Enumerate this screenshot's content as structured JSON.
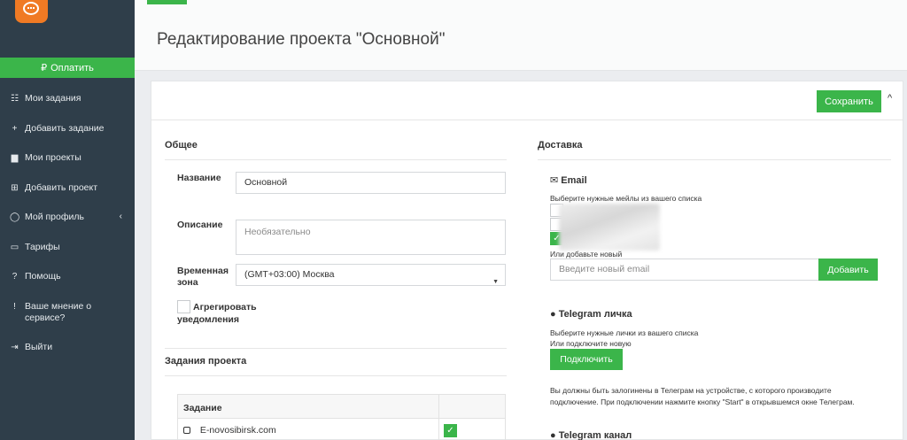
{
  "sidebar": {
    "pay_label": "Оплатить",
    "items": [
      {
        "label": "Мои задания",
        "icon": "list-icon",
        "glyph": "☷"
      },
      {
        "label": "Добавить задание",
        "icon": "plus-icon",
        "glyph": "+"
      },
      {
        "label": "Мои проекты",
        "icon": "briefcase-icon",
        "glyph": "▆"
      },
      {
        "label": "Добавить проект",
        "icon": "plus-square-icon",
        "glyph": "⊞"
      },
      {
        "label": "Мой профиль",
        "icon": "user-icon",
        "glyph": "◯"
      },
      {
        "label": "Тарифы",
        "icon": "card-icon",
        "glyph": "▭"
      },
      {
        "label": "Помощь",
        "icon": "question-icon",
        "glyph": "?"
      },
      {
        "label": "Ваше мнение о сервисе?",
        "icon": "exclamation-icon",
        "glyph": "!"
      },
      {
        "label": "Выйти",
        "icon": "sign-out-icon",
        "glyph": "⇥"
      }
    ],
    "profile_chevron": "‹"
  },
  "header": {
    "title": "Редактирование проекта \"Основной\""
  },
  "toolbar": {
    "save_label": "Сохранить",
    "collapse_icon": "^"
  },
  "general": {
    "title": "Общее",
    "name_label": "Название",
    "name_value": "Основной",
    "desc_label": "Описание",
    "desc_placeholder": "Необязательно",
    "tz_label": "Временная зона",
    "tz_value": "(GMT+03:00) Москва",
    "aggregate_label": "Агрегировать уведомления",
    "aggregate_checked": false
  },
  "tasks": {
    "title": "Задания проекта",
    "column_task": "Задание",
    "rows": [
      {
        "name": "E-novosibirsk.com",
        "enabled": true
      }
    ]
  },
  "delivery": {
    "title": "Доставка",
    "email": {
      "title": "Email",
      "choose_hint": "Выберите нужные мейлы из вашего списка",
      "checkboxes": [
        false,
        false,
        true
      ],
      "or_add": "Или добавьте новый",
      "input_placeholder": "Введите новый email",
      "add_label": "Добавить"
    },
    "telegram_personal": {
      "title": "Telegram личка",
      "choose_hint": "Выберите нужные лички из вашего списка",
      "or_connect": "Или подключите новую",
      "connect_label": "Подключить",
      "note": "Вы должны быть залогинены в Телеграм на устройстве, с которого производите подключение. При подключении нажмите кнопку \"Start\" в открывшемся окне Телеграм."
    },
    "telegram_channel": {
      "title": "Telegram канал"
    }
  },
  "colors": {
    "accent": "#3bb54a",
    "sidebar_bg": "#2f3e4a",
    "logo": "#f07a24"
  }
}
